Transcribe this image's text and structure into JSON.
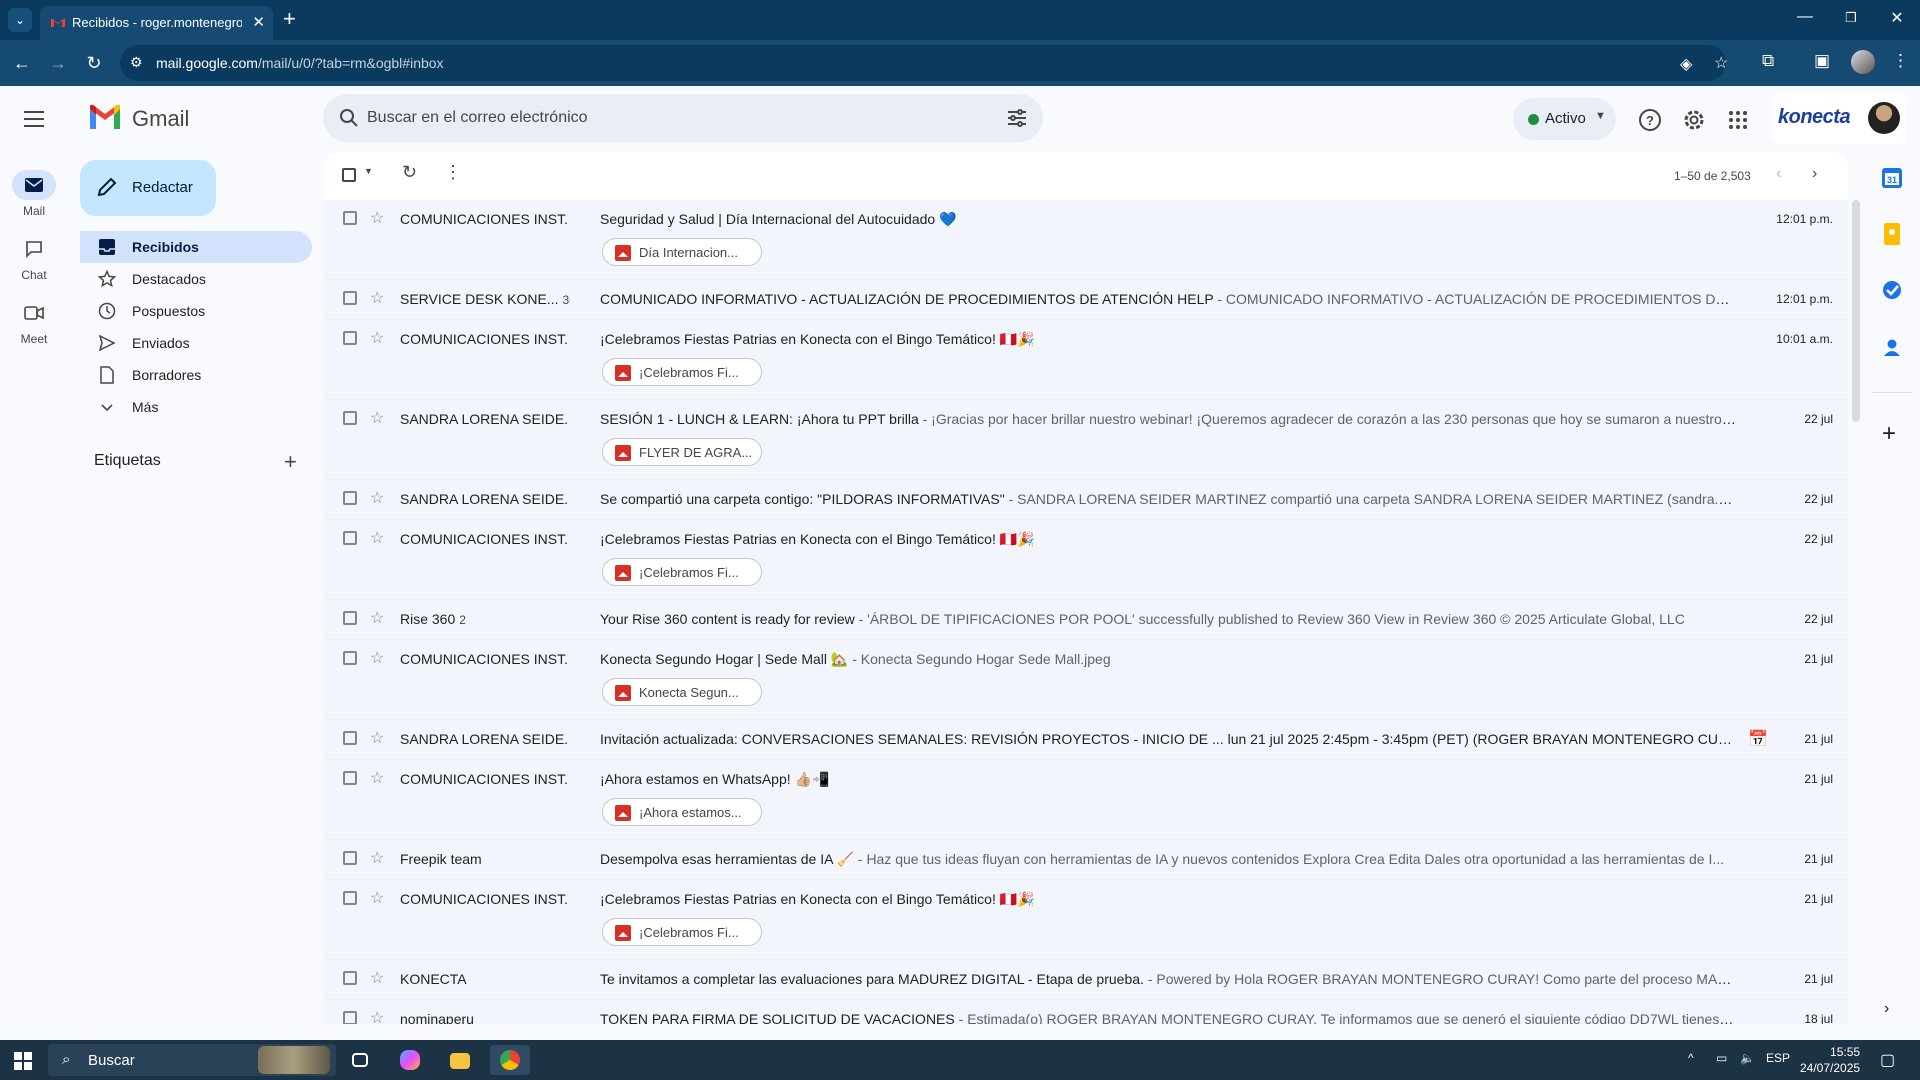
{
  "browser": {
    "tab_title": "Recibidos - roger.montenegro@",
    "url_domain": "mail.google.com",
    "url_path": "/mail/u/0/?tab=rm&ogbl#inbox"
  },
  "app": {
    "name": "Gmail",
    "search_placeholder": "Buscar en el correo electrónico",
    "status": "Activo",
    "org_brand": "konecta",
    "accent_color": "#0b57d0"
  },
  "rail": {
    "items": [
      {
        "label": "Mail",
        "icon": "mail-icon"
      },
      {
        "label": "Chat",
        "icon": "chat-icon"
      },
      {
        "label": "Meet",
        "icon": "meet-icon"
      }
    ]
  },
  "nav": {
    "compose": "Redactar",
    "items": [
      {
        "label": "Recibidos",
        "icon": "inbox-icon"
      },
      {
        "label": "Destacados",
        "icon": "star-icon"
      },
      {
        "label": "Pospuestos",
        "icon": "clock-icon"
      },
      {
        "label": "Enviados",
        "icon": "send-icon"
      },
      {
        "label": "Borradores",
        "icon": "draft-icon"
      },
      {
        "label": "Más",
        "icon": "chevron-down-icon"
      }
    ],
    "labels_title": "Etiquetas"
  },
  "list": {
    "pagination": "1–50 de 2,503",
    "emails": [
      {
        "sender": "COMUNICACIONES INST.",
        "count": "",
        "subject": "Seguridad y Salud | Día Internacional del Autocuidado 💙",
        "snippet": "",
        "date": "12:01 p.m.",
        "attachment": "Día Internacion..."
      },
      {
        "sender": "SERVICE DESK KONE...",
        "count": "36",
        "subject": "COMUNICADO INFORMATIVO - ACTUALIZACIÓN DE PROCEDIMIENTOS DE ATENCIÓN HELP",
        "snippet": " - COMUNICADO INFORMATIVO - ACTUALIZACIÓN DE PROCEDIMIENTOS DE ATENCIÓ...",
        "date": "12:01 p.m.",
        "attachment": ""
      },
      {
        "sender": "COMUNICACIONES INST.",
        "count": "",
        "subject": "¡Celebramos Fiestas Patrias en Konecta con el Bingo Temático! 🇵🇪🎉",
        "snippet": "",
        "date": "10:01 a.m.",
        "attachment": "¡Celebramos Fi..."
      },
      {
        "sender": "SANDRA LORENA SEIDE.",
        "count": "",
        "subject": "SESIÓN 1 - LUNCH & LEARN: ¡Ahora tu PPT brilla",
        "snippet": " - ¡Gracias por hacer brillar nuestro webinar! ¡Queremos agradecer de corazón a las 230 personas que hoy se sumaron a nuestro ...",
        "date": "22 jul",
        "attachment": "FLYER DE AGRA..."
      },
      {
        "sender": "SANDRA LORENA SEIDE.",
        "count": "",
        "subject": "Se compartió una carpeta contigo: \"PILDORAS INFORMATIVAS\"",
        "snippet": " - SANDRA LORENA SEIDER MARTINEZ compartió una carpeta SANDRA LORENA SEIDER MARTINEZ (sandra.seider...",
        "date": "22 jul",
        "attachment": ""
      },
      {
        "sender": "COMUNICACIONES INST.",
        "count": "",
        "subject": "¡Celebramos Fiestas Patrias en Konecta con el Bingo Temático! 🇵🇪🎉",
        "snippet": "",
        "date": "22 jul",
        "attachment": "¡Celebramos Fi..."
      },
      {
        "sender": "Rise 360",
        "count": "2",
        "subject": "Your Rise 360 content is ready for review",
        "snippet": " - 'ÁRBOL DE TIPIFICACIONES POR POOL' successfully published to Review 360 View in Review 360 © 2025 Articulate Global, LLC",
        "date": "22 jul",
        "attachment": ""
      },
      {
        "sender": "COMUNICACIONES INST.",
        "count": "",
        "subject": "Konecta Segundo Hogar | Sede Mall 🏡",
        "snippet": " - Konecta Segundo Hogar Sede Mall.jpeg",
        "date": "21 jul",
        "attachment": "Konecta Segun..."
      },
      {
        "sender": "SANDRA LORENA SEIDE.",
        "count": "",
        "subject": "Invitación actualizada: CONVERSACIONES SEMANALES: REVISIÓN PROYECTOS - INICIO DE ... lun 21 jul 2025 2:45pm - 3:45pm (PET) (ROGER BRAYAN MONTENEGRO CURAY)",
        "snippet": " - CO...",
        "date": "21 jul",
        "attachment": "",
        "calendar": true
      },
      {
        "sender": "COMUNICACIONES INST.",
        "count": "",
        "subject": "¡Ahora estamos en WhatsApp! 👍🏼📲",
        "snippet": "",
        "date": "21 jul",
        "attachment": "¡Ahora estamos..."
      },
      {
        "sender": "Freepik team",
        "count": "",
        "subject": "Desempolva esas herramientas de IA 🧹",
        "snippet": " - Haz que tus ideas fluyan con herramientas de IA y nuevos contenidos Explora Crea Edita Dales otra oportunidad a las herramientas de I...",
        "date": "21 jul",
        "attachment": ""
      },
      {
        "sender": "COMUNICACIONES INST.",
        "count": "",
        "subject": "¡Celebramos Fiestas Patrias en Konecta con el Bingo Temático! 🇵🇪🎉",
        "snippet": "",
        "date": "21 jul",
        "attachment": "¡Celebramos Fi..."
      },
      {
        "sender": "KONECTA",
        "count": "",
        "subject": "Te invitamos a completar las evaluaciones para MADUREZ DIGITAL - Etapa de prueba.",
        "snippet": " - Powered by Hola ROGER BRAYAN MONTENEGRO CURAY! Como parte del proceso MADUR...",
        "date": "21 jul",
        "attachment": ""
      },
      {
        "sender": "nominaperu",
        "count": "",
        "subject": "TOKEN PARA FIRMA DE SOLICITUD DE VACACIONES",
        "snippet": " - Estimada(o) ROGER BRAYAN MONTENEGRO CURAY, Te informamos que se generó el siguiente código DD7WL tienes que in...",
        "date": "18 jul",
        "attachment": ""
      }
    ]
  },
  "taskbar": {
    "search": "Buscar",
    "lang": "ESP",
    "time": "15:55",
    "date": "24/07/2025"
  }
}
